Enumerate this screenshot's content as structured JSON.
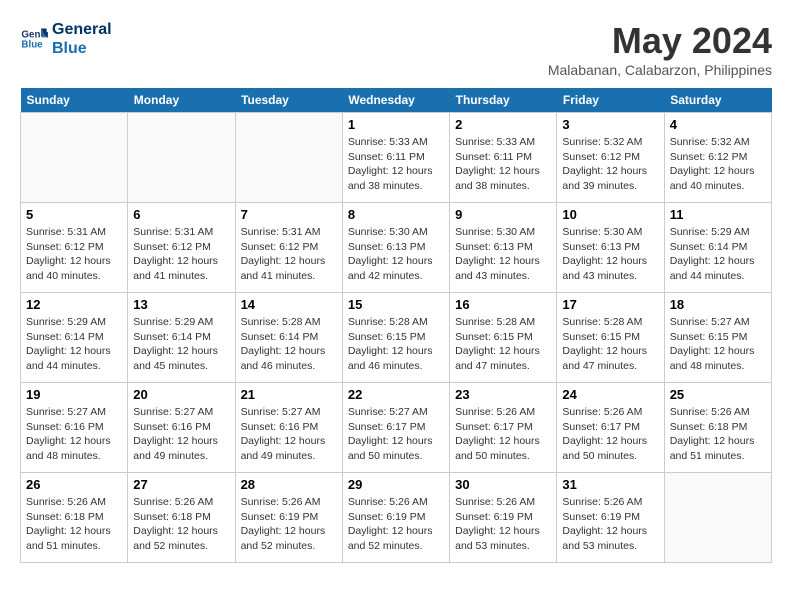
{
  "logo": {
    "line1": "General",
    "line2": "Blue"
  },
  "title": "May 2024",
  "location": "Malabanan, Calabarzon, Philippines",
  "headers": [
    "Sunday",
    "Monday",
    "Tuesday",
    "Wednesday",
    "Thursday",
    "Friday",
    "Saturday"
  ],
  "weeks": [
    [
      {
        "date": "",
        "info": ""
      },
      {
        "date": "",
        "info": ""
      },
      {
        "date": "",
        "info": ""
      },
      {
        "date": "1",
        "info": "Sunrise: 5:33 AM\nSunset: 6:11 PM\nDaylight: 12 hours\nand 38 minutes."
      },
      {
        "date": "2",
        "info": "Sunrise: 5:33 AM\nSunset: 6:11 PM\nDaylight: 12 hours\nand 38 minutes."
      },
      {
        "date": "3",
        "info": "Sunrise: 5:32 AM\nSunset: 6:12 PM\nDaylight: 12 hours\nand 39 minutes."
      },
      {
        "date": "4",
        "info": "Sunrise: 5:32 AM\nSunset: 6:12 PM\nDaylight: 12 hours\nand 40 minutes."
      }
    ],
    [
      {
        "date": "5",
        "info": "Sunrise: 5:31 AM\nSunset: 6:12 PM\nDaylight: 12 hours\nand 40 minutes."
      },
      {
        "date": "6",
        "info": "Sunrise: 5:31 AM\nSunset: 6:12 PM\nDaylight: 12 hours\nand 41 minutes."
      },
      {
        "date": "7",
        "info": "Sunrise: 5:31 AM\nSunset: 6:12 PM\nDaylight: 12 hours\nand 41 minutes."
      },
      {
        "date": "8",
        "info": "Sunrise: 5:30 AM\nSunset: 6:13 PM\nDaylight: 12 hours\nand 42 minutes."
      },
      {
        "date": "9",
        "info": "Sunrise: 5:30 AM\nSunset: 6:13 PM\nDaylight: 12 hours\nand 43 minutes."
      },
      {
        "date": "10",
        "info": "Sunrise: 5:30 AM\nSunset: 6:13 PM\nDaylight: 12 hours\nand 43 minutes."
      },
      {
        "date": "11",
        "info": "Sunrise: 5:29 AM\nSunset: 6:14 PM\nDaylight: 12 hours\nand 44 minutes."
      }
    ],
    [
      {
        "date": "12",
        "info": "Sunrise: 5:29 AM\nSunset: 6:14 PM\nDaylight: 12 hours\nand 44 minutes."
      },
      {
        "date": "13",
        "info": "Sunrise: 5:29 AM\nSunset: 6:14 PM\nDaylight: 12 hours\nand 45 minutes."
      },
      {
        "date": "14",
        "info": "Sunrise: 5:28 AM\nSunset: 6:14 PM\nDaylight: 12 hours\nand 46 minutes."
      },
      {
        "date": "15",
        "info": "Sunrise: 5:28 AM\nSunset: 6:15 PM\nDaylight: 12 hours\nand 46 minutes."
      },
      {
        "date": "16",
        "info": "Sunrise: 5:28 AM\nSunset: 6:15 PM\nDaylight: 12 hours\nand 47 minutes."
      },
      {
        "date": "17",
        "info": "Sunrise: 5:28 AM\nSunset: 6:15 PM\nDaylight: 12 hours\nand 47 minutes."
      },
      {
        "date": "18",
        "info": "Sunrise: 5:27 AM\nSunset: 6:15 PM\nDaylight: 12 hours\nand 48 minutes."
      }
    ],
    [
      {
        "date": "19",
        "info": "Sunrise: 5:27 AM\nSunset: 6:16 PM\nDaylight: 12 hours\nand 48 minutes."
      },
      {
        "date": "20",
        "info": "Sunrise: 5:27 AM\nSunset: 6:16 PM\nDaylight: 12 hours\nand 49 minutes."
      },
      {
        "date": "21",
        "info": "Sunrise: 5:27 AM\nSunset: 6:16 PM\nDaylight: 12 hours\nand 49 minutes."
      },
      {
        "date": "22",
        "info": "Sunrise: 5:27 AM\nSunset: 6:17 PM\nDaylight: 12 hours\nand 50 minutes."
      },
      {
        "date": "23",
        "info": "Sunrise: 5:26 AM\nSunset: 6:17 PM\nDaylight: 12 hours\nand 50 minutes."
      },
      {
        "date": "24",
        "info": "Sunrise: 5:26 AM\nSunset: 6:17 PM\nDaylight: 12 hours\nand 50 minutes."
      },
      {
        "date": "25",
        "info": "Sunrise: 5:26 AM\nSunset: 6:18 PM\nDaylight: 12 hours\nand 51 minutes."
      }
    ],
    [
      {
        "date": "26",
        "info": "Sunrise: 5:26 AM\nSunset: 6:18 PM\nDaylight: 12 hours\nand 51 minutes."
      },
      {
        "date": "27",
        "info": "Sunrise: 5:26 AM\nSunset: 6:18 PM\nDaylight: 12 hours\nand 52 minutes."
      },
      {
        "date": "28",
        "info": "Sunrise: 5:26 AM\nSunset: 6:19 PM\nDaylight: 12 hours\nand 52 minutes."
      },
      {
        "date": "29",
        "info": "Sunrise: 5:26 AM\nSunset: 6:19 PM\nDaylight: 12 hours\nand 52 minutes."
      },
      {
        "date": "30",
        "info": "Sunrise: 5:26 AM\nSunset: 6:19 PM\nDaylight: 12 hours\nand 53 minutes."
      },
      {
        "date": "31",
        "info": "Sunrise: 5:26 AM\nSunset: 6:19 PM\nDaylight: 12 hours\nand 53 minutes."
      },
      {
        "date": "",
        "info": ""
      }
    ]
  ]
}
